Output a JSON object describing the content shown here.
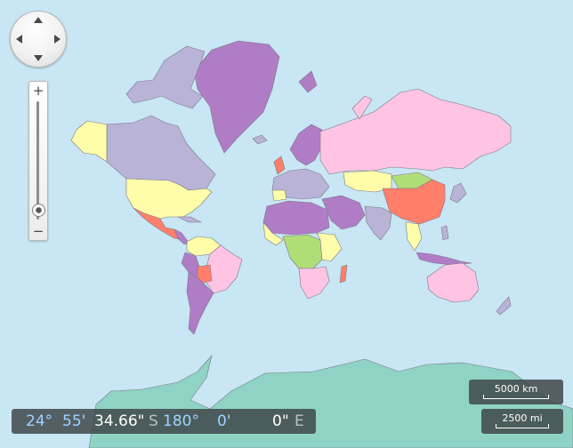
{
  "map": {
    "colors": {
      "ocean": "#c8e6f3",
      "purple": "#b07cc6",
      "lavender": "#b9b3d8",
      "pink": "#ffc4e3",
      "yellow": "#fffcaa",
      "orange": "#ff7f6a",
      "green": "#b1dd77",
      "blue": "#70a8d8",
      "antarctica": "#8fd3c4"
    }
  },
  "navigation": {
    "pan_up": "pan-up",
    "pan_down": "pan-down",
    "pan_left": "pan-left",
    "pan_right": "pan-right",
    "zoom_in": "+",
    "zoom_out": "−",
    "zoom_level_fraction": 0.08
  },
  "coordinates": {
    "lat_deg": "24°",
    "lat_min": "55'",
    "lat_sec": "34.66\"",
    "lat_hem": "S",
    "lon_deg": "180°",
    "lon_min": "0'",
    "lon_sec": "0\"",
    "lon_hem": "E"
  },
  "scale": {
    "metric": "5000 km",
    "imperial": "2500 mi"
  }
}
